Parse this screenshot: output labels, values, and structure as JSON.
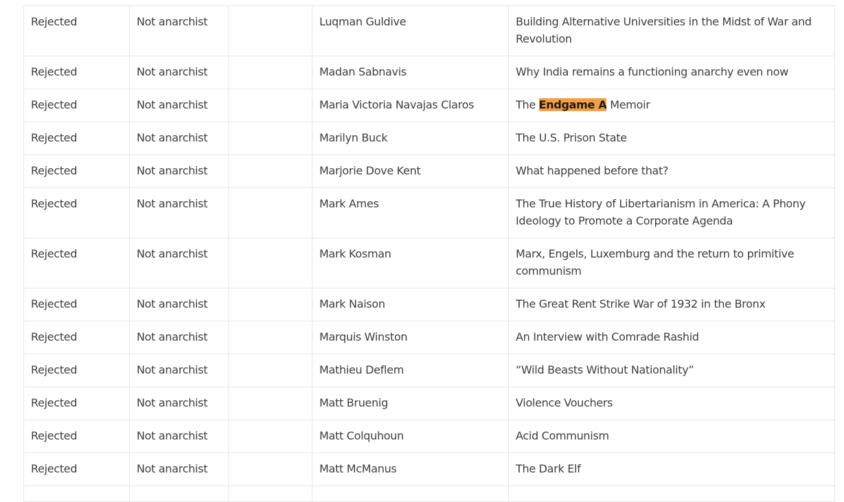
{
  "rows": [
    {
      "status": "Rejected",
      "reason": "Not anarchist",
      "extra": "",
      "author": "Luqman Guldive",
      "title": "Building Alternative Universities in the Midst of War and Revolution"
    },
    {
      "status": "Rejected",
      "reason": "Not anarchist",
      "extra": "",
      "author": "Madan Sabnavis",
      "title": "Why India remains a functioning anarchy even now"
    },
    {
      "status": "Rejected",
      "reason": "Not anarchist",
      "extra": "",
      "author": "Maria Victoria Navajas Claros",
      "title_pre": "The ",
      "title_highlight": "Endgame A",
      "title_post": " Memoir"
    },
    {
      "status": "Rejected",
      "reason": "Not anarchist",
      "extra": "",
      "author": "Marilyn Buck",
      "title": "The U.S. Prison State"
    },
    {
      "status": "Rejected",
      "reason": "Not anarchist",
      "extra": "",
      "author": "Marjorie Dove Kent",
      "title": "What happened before that?"
    },
    {
      "status": "Rejected",
      "reason": "Not anarchist",
      "extra": "",
      "author": "Mark Ames",
      "title": "The True History of Libertarianism in America: A Phony Ideology to Promote a Corporate Agenda"
    },
    {
      "status": "Rejected",
      "reason": "Not anarchist",
      "extra": "",
      "author": "Mark Kosman",
      "title": "Marx, Engels, Luxemburg and the return to primitive communism"
    },
    {
      "status": "Rejected",
      "reason": "Not anarchist",
      "extra": "",
      "author": "Mark Naison",
      "title": "The Great Rent Strike War of 1932 in the Bronx"
    },
    {
      "status": "Rejected",
      "reason": "Not anarchist",
      "extra": "",
      "author": "Marquis Winston",
      "title": "An Interview with Comrade Rashid"
    },
    {
      "status": "Rejected",
      "reason": "Not anarchist",
      "extra": "",
      "author": "Mathieu Deflem",
      "title": "“Wild Beasts Without Nationality”"
    },
    {
      "status": "Rejected",
      "reason": "Not anarchist",
      "extra": "",
      "author": "Matt Bruenig",
      "title": "Violence Vouchers"
    },
    {
      "status": "Rejected",
      "reason": "Not anarchist",
      "extra": "",
      "author": "Matt Colquhoun",
      "title": "Acid Communism"
    },
    {
      "status": "Rejected",
      "reason": "Not anarchist",
      "extra": "",
      "author": "Matt McManus",
      "title": "The Dark Elf"
    },
    {
      "status": "",
      "reason": "",
      "extra": "",
      "author": "",
      "title": ""
    }
  ],
  "colors": {
    "highlight": "#f5a046",
    "border": "#e6e6e6",
    "text": "#3d3d3d"
  }
}
